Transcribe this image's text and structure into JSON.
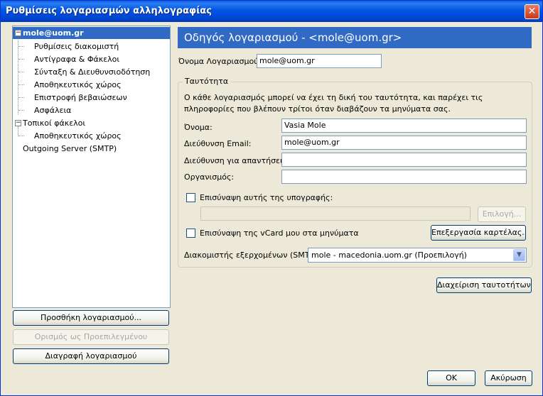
{
  "window": {
    "title": "Ρυθμίσεις λογαριασμών αλληλογραφίας",
    "close_glyph": "✕"
  },
  "tree": {
    "account": "mole@uom.gr",
    "account_children": [
      "Ρυθμίσεις διακομιστή",
      "Αντίγραφα & Φάκελοι",
      "Σύνταξη & Διευθυνσιοδότηση",
      "Αποθηκευτικός χώρος",
      "Επιστροφή βεβαιώσεων",
      "Ασφάλεια"
    ],
    "local": "Τοπικοί φάκελοι",
    "local_children": [
      "Αποθηκευτικός χώρος"
    ],
    "smtp": "Outgoing Server (SMTP)",
    "toggle_glyph": "−"
  },
  "left_buttons": {
    "add": "Προσθήκη λογαριασμού...",
    "set_default": "Ορισμός ως Προεπιλεγμένου",
    "delete": "Διαγραφή λογαριασμού"
  },
  "panel": {
    "banner": "Οδηγός λογαριασμού - <mole@uom.gr>",
    "account_name_label": "Όνομα Λογαριασμού:",
    "account_name_value": "mole@uom.gr",
    "identity_group": "Ταυτότητα",
    "identity_desc": "Ο κάθε λογαριασμός μπορεί να έχει τη δική του ταυτότητα, και παρέχει τις πληροφορίες που βλέπουν τρίτοι όταν διαβάζουν τα μηνύματα σας.",
    "name_label": "Όνομα:",
    "name_value": "Vasia Mole",
    "email_label": "Διεύθυνση Email:",
    "email_value": "mole@uom.gr",
    "reply_label": "Διεύθυνση για απαντήσεις:",
    "reply_value": "",
    "org_label": "Οργανισμός:",
    "org_value": "",
    "attach_sig_label": "Επισύναψη αυτής της υπογραφής:",
    "sig_path": "",
    "choose_button": "Επιλογή...",
    "vcard_label": "Επισύναψη της vCard μου στα μηνύματα",
    "edit_card_button": "Επεξεργασία καρτέλας...",
    "smtp_label": "Διακομιστής εξερχομένων (SMTP):",
    "smtp_value": "mole - macedonia.uom.gr (Προεπιλογή)",
    "manage_identities_button": "Διαχείριση ταυτοτήτων..."
  },
  "footer": {
    "ok": "OK",
    "cancel": "Ακύρωση"
  }
}
